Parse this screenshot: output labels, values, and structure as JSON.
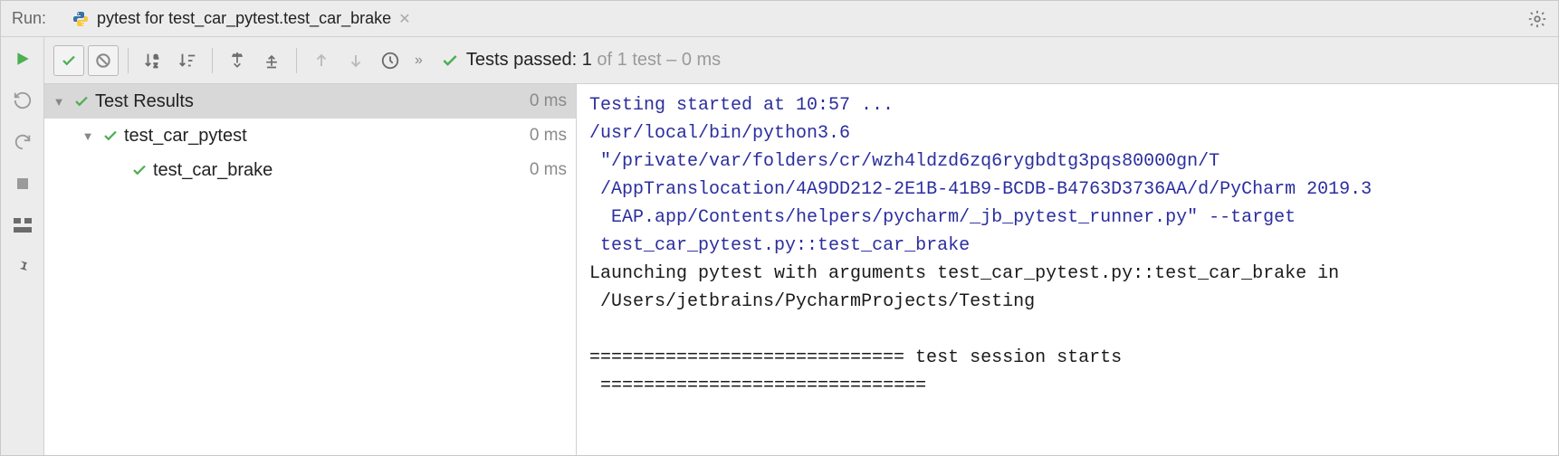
{
  "header": {
    "label": "Run:",
    "tab_title": "pytest for test_car_pytest.test_car_brake"
  },
  "status": {
    "prefix": "Tests passed: ",
    "count": "1",
    "suffix": " of 1 test – 0 ms"
  },
  "tree": [
    {
      "label": "Test Results",
      "time": "0 ms",
      "level": 0,
      "expandable": true,
      "selected": true
    },
    {
      "label": "test_car_pytest",
      "time": "0 ms",
      "level": 1,
      "expandable": true,
      "selected": false
    },
    {
      "label": "test_car_brake",
      "time": "0 ms",
      "level": 2,
      "expandable": false,
      "selected": false
    }
  ],
  "console": {
    "l1": "Testing started at 10:57 ...",
    "l2": "/usr/local/bin/python3.6 ",
    "l3": " \"/private/var/folders/cr/wzh4ldzd6zq6rygbdtg3pqs80000gn/T",
    "l4": " /AppTranslocation/4A9DD212-2E1B-41B9-BCDB-B4763D3736AA/d/PyCharm 2019.3",
    "l5": "  EAP.app/Contents/helpers/pycharm/_jb_pytest_runner.py\" --target ",
    "l6": " test_car_pytest.py::test_car_brake",
    "l7": "Launching pytest with arguments test_car_pytest.py::test_car_brake in",
    "l8": " /Users/jetbrains/PycharmProjects/Testing",
    "l9": "",
    "l10": "============================= test session starts ",
    "l11": " =============================="
  }
}
